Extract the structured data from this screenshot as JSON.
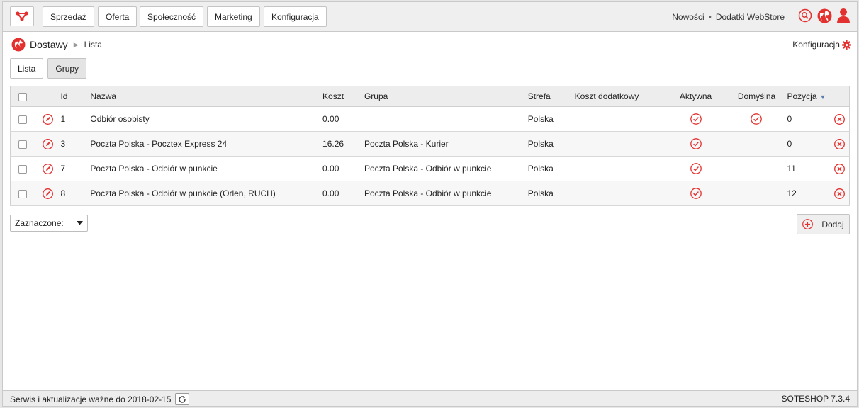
{
  "nav": {
    "items": [
      "Sprzedaż",
      "Oferta",
      "Społeczność",
      "Marketing",
      "Konfiguracja"
    ],
    "news": "Nowości",
    "sep": "•",
    "addons": "Dodatki WebStore"
  },
  "breadcrumb": {
    "main": "Dostawy",
    "sep": "▶",
    "sub": "Lista"
  },
  "config_link": "Konfiguracja",
  "tabs": [
    "Lista",
    "Grupy"
  ],
  "table": {
    "headers": [
      "Id",
      "Nazwa",
      "Koszt",
      "Grupa",
      "Strefa",
      "Koszt dodatkowy",
      "Aktywna",
      "Domyślna",
      "Pozycja"
    ],
    "sort_indicator": "▼",
    "rows": [
      {
        "id": "1",
        "name": "Odbiór osobisty",
        "cost": "0.00",
        "group": "",
        "zone": "Polska",
        "extra": "",
        "active": true,
        "default": true,
        "position": "0"
      },
      {
        "id": "3",
        "name": "Poczta Polska - Pocztex Express 24",
        "cost": "16.26",
        "group": "Poczta Polska - Kurier",
        "zone": "Polska",
        "extra": "",
        "active": true,
        "default": false,
        "position": "0"
      },
      {
        "id": "7",
        "name": "Poczta Polska - Odbiór w punkcie",
        "cost": "0.00",
        "group": "Poczta Polska - Odbiór w punkcie",
        "zone": "Polska",
        "extra": "",
        "active": true,
        "default": false,
        "position": "11"
      },
      {
        "id": "8",
        "name": "Poczta Polska - Odbiór w punkcie (Orlen, RUCH)",
        "cost": "0.00",
        "group": "Poczta Polska - Odbiór w punkcie",
        "zone": "Polska",
        "extra": "",
        "active": true,
        "default": false,
        "position": "12"
      }
    ]
  },
  "bulk": {
    "label": "Zaznaczone:"
  },
  "add_button": "Dodaj",
  "footer": {
    "service": "Serwis i aktualizacje ważne do 2018-02-15",
    "version": "SOTESHOP 7.3.4"
  },
  "colors": {
    "accent": "#e3312f",
    "header_bg": "#ededed",
    "sort_arrow": "#5a7fae"
  }
}
